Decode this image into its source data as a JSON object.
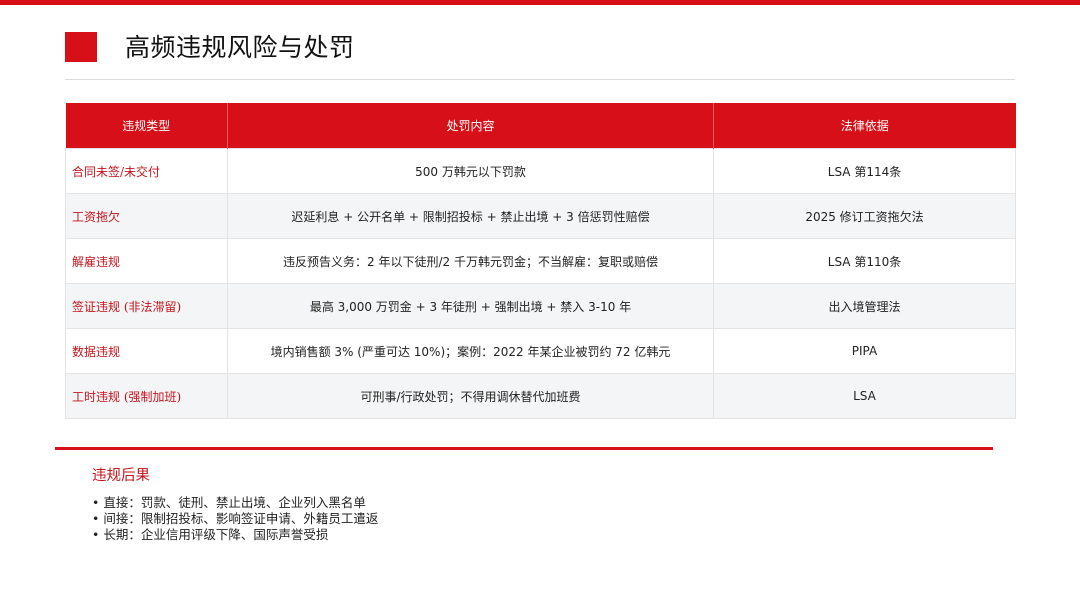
{
  "slide": {
    "title": "高频违规风险与处罚",
    "accent_color": "#d60f18"
  },
  "table": {
    "headers": [
      "违规类型",
      "处罚内容",
      "法律依据"
    ],
    "rows": [
      {
        "type": "合同未签/未交付",
        "content": "500 万韩元以下罚款",
        "law": "LSA 第114条"
      },
      {
        "type": "工资拖欠",
        "content": "迟延利息 + 公开名单 + 限制招投标 + 禁止出境 + 3 倍惩罚性赔偿",
        "law": "2025 修订工资拖欠法"
      },
      {
        "type": "解雇违规",
        "content": "违反预告义务：2 年以下徒刑/2 千万韩元罚金；不当解雇：复职或赔偿",
        "law": "LSA 第110条"
      },
      {
        "type": "签证违规 (非法滞留)",
        "content": "最高 3,000 万罚金 + 3 年徒刑 + 强制出境 + 禁入 3-10 年",
        "law": "出入境管理法"
      },
      {
        "type": "数据违规",
        "content": "境内销售额 3% (严重可达 10%)；案例：2022 年某企业被罚约 72 亿韩元",
        "law": "PIPA"
      },
      {
        "type": "工时违规 (强制加班)",
        "content": "可刑事/行政处罚；不得用调休替代加班费",
        "law": "LSA"
      }
    ]
  },
  "consequences": {
    "title": "违规后果",
    "items": [
      "直接：罚款、徒刑、禁止出境、企业列入黑名单",
      "间接：限制招投标、影响签证申请、外籍员工遣返",
      "长期：企业信用评级下降、国际声誉受损"
    ]
  }
}
